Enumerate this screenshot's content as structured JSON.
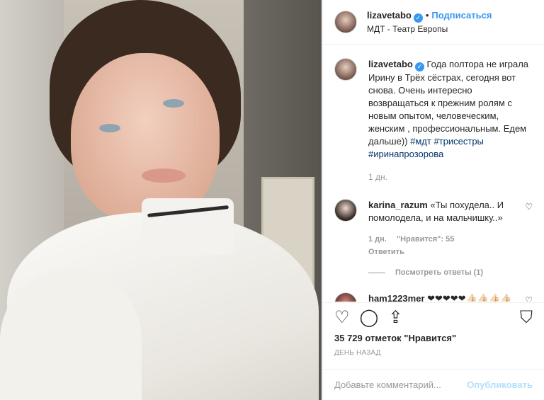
{
  "header": {
    "username": "lizavetabo",
    "separator": "•",
    "follow_label": "Подписаться",
    "location": "МДТ - Театр Европы"
  },
  "caption": {
    "username": "lizavetabo",
    "text": "Года полтора не играла Ирину в Трёх сёстрах, сегодня вот снова. Очень интересно возвращаться к прежним ролям с новым опытом, человеческим, женским , профессиональным. Едем дальше))",
    "tags": [
      "#мдт",
      "#трисестры",
      "#иринапрозорова"
    ],
    "time": "1 дн."
  },
  "comments": [
    {
      "username": "karina_razum",
      "text": "«Ты похудела.. И помолодела, и на мальчишку..»⁣",
      "time": "1 дн.",
      "likes": "\"Нравится\": 55",
      "reply_label": "Ответить",
      "view_replies": "Посмотреть ответы (1)"
    },
    {
      "username": "ham1223mer",
      "text": "❤❤❤❤❤👍🏻👍🏻👍🏻👍🏻 😊😊😊😊"
    }
  ],
  "actions": {
    "likes": "35 729 отметок \"Нравится\"",
    "date": "ДЕНЬ НАЗАД"
  },
  "add_comment": {
    "placeholder": "Добавьте комментарий...",
    "publish_label": "Опубликовать"
  },
  "colors": {
    "link": "#3897f0",
    "hashtag": "#003569",
    "muted": "#999999"
  }
}
